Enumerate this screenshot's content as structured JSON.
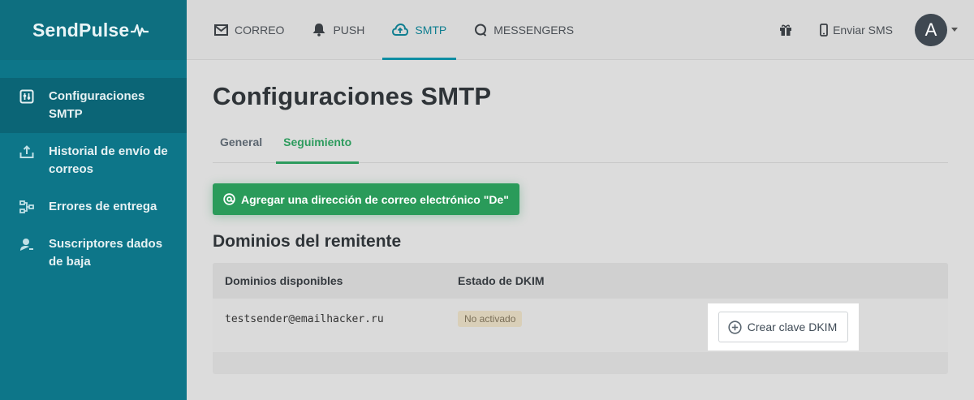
{
  "brand": {
    "name": "SendPulse"
  },
  "sidebar": {
    "items": [
      {
        "label": "Configuraciones SMTP",
        "icon": "settings-sliders-icon",
        "active": true
      },
      {
        "label": "Historial de envío de correos",
        "icon": "outbox-icon",
        "active": false
      },
      {
        "label": "Errores de entrega",
        "icon": "error-flow-icon",
        "active": false
      },
      {
        "label": "Suscriptores dados de baja",
        "icon": "user-remove-icon",
        "active": false
      }
    ]
  },
  "topnav": {
    "items": [
      {
        "label": "CORREO",
        "icon": "envelope-icon",
        "active": false
      },
      {
        "label": "PUSH",
        "icon": "bell-icon",
        "active": false
      },
      {
        "label": "SMTP",
        "icon": "cloud-upload-icon",
        "active": true
      },
      {
        "label": "MESSENGERS",
        "icon": "chat-bubble-icon",
        "active": false
      }
    ],
    "sms_label": "Enviar SMS",
    "avatar_letter": "A"
  },
  "page": {
    "title": "Configuraciones SMTP",
    "tabs": [
      {
        "label": "General",
        "active": false
      },
      {
        "label": "Seguimiento",
        "active": true
      }
    ],
    "add_sender_button": "Agregar una dirección de correo electrónico \"De\"",
    "section_title": "Dominios del remitente",
    "table": {
      "headers": [
        "Dominios disponibles",
        "Estado de DKIM",
        ""
      ],
      "rows": [
        {
          "domain": "testsender@emailhacker.ru",
          "status": "No activado",
          "action": "Crear clave DKIM"
        }
      ]
    }
  },
  "colors": {
    "sidebar_bg": "#0d7689",
    "accent_teal": "#0f8ea3",
    "accent_green": "#2a9b5a",
    "avatar_bg": "#3f4851"
  }
}
